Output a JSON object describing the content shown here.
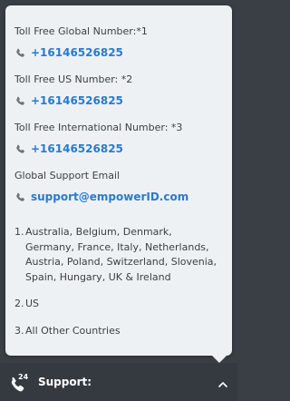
{
  "contact": {
    "entries": [
      {
        "label": "Toll Free Global Number:*1",
        "value": "+16146526825",
        "icon": "phone-icon"
      },
      {
        "label": "Toll Free US Number: *2",
        "value": "+16146526825",
        "icon": "phone-icon"
      },
      {
        "label": "Toll Free International Number: *3",
        "value": "+16146526825",
        "icon": "phone-icon"
      },
      {
        "label": "Global Support Email",
        "value": "support@empowerID.com",
        "icon": "phone-icon"
      }
    ]
  },
  "regions": [
    {
      "num": "1.",
      "text": "Australia, Belgium, Denmark, Germany, France, Italy, Netherlands, Austria, Poland, Switzerland, Slovenia, Spain, Hungary, UK & Ireland"
    },
    {
      "num": "2.",
      "text": "US"
    },
    {
      "num": "3.",
      "text": "All Other Countries"
    }
  ],
  "footer": {
    "label": "Support:",
    "badge": "24",
    "icon": "support-24-phone-icon",
    "toggle_icon": "chevron-up-icon"
  },
  "colors": {
    "link": "#2b7bc9",
    "popup_bg": "#eef1f4",
    "footer_bg": "#353a41"
  }
}
